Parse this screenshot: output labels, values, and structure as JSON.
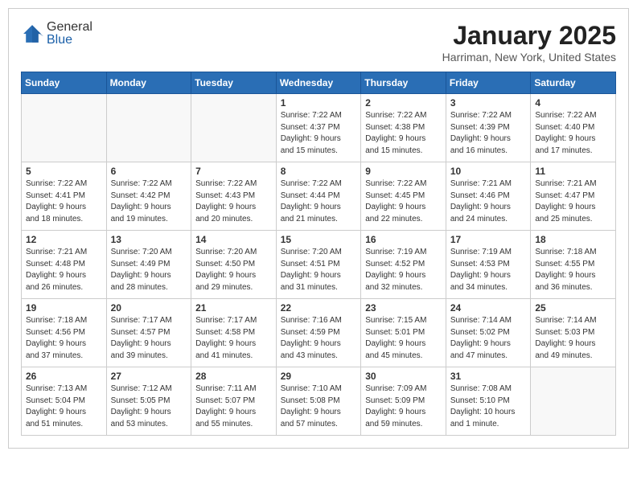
{
  "header": {
    "logo_general": "General",
    "logo_blue": "Blue",
    "month": "January 2025",
    "location": "Harriman, New York, United States"
  },
  "days_of_week": [
    "Sunday",
    "Monday",
    "Tuesday",
    "Wednesday",
    "Thursday",
    "Friday",
    "Saturday"
  ],
  "weeks": [
    [
      {
        "day": "",
        "info": ""
      },
      {
        "day": "",
        "info": ""
      },
      {
        "day": "",
        "info": ""
      },
      {
        "day": "1",
        "info": "Sunrise: 7:22 AM\nSunset: 4:37 PM\nDaylight: 9 hours\nand 15 minutes."
      },
      {
        "day": "2",
        "info": "Sunrise: 7:22 AM\nSunset: 4:38 PM\nDaylight: 9 hours\nand 15 minutes."
      },
      {
        "day": "3",
        "info": "Sunrise: 7:22 AM\nSunset: 4:39 PM\nDaylight: 9 hours\nand 16 minutes."
      },
      {
        "day": "4",
        "info": "Sunrise: 7:22 AM\nSunset: 4:40 PM\nDaylight: 9 hours\nand 17 minutes."
      }
    ],
    [
      {
        "day": "5",
        "info": "Sunrise: 7:22 AM\nSunset: 4:41 PM\nDaylight: 9 hours\nand 18 minutes."
      },
      {
        "day": "6",
        "info": "Sunrise: 7:22 AM\nSunset: 4:42 PM\nDaylight: 9 hours\nand 19 minutes."
      },
      {
        "day": "7",
        "info": "Sunrise: 7:22 AM\nSunset: 4:43 PM\nDaylight: 9 hours\nand 20 minutes."
      },
      {
        "day": "8",
        "info": "Sunrise: 7:22 AM\nSunset: 4:44 PM\nDaylight: 9 hours\nand 21 minutes."
      },
      {
        "day": "9",
        "info": "Sunrise: 7:22 AM\nSunset: 4:45 PM\nDaylight: 9 hours\nand 22 minutes."
      },
      {
        "day": "10",
        "info": "Sunrise: 7:21 AM\nSunset: 4:46 PM\nDaylight: 9 hours\nand 24 minutes."
      },
      {
        "day": "11",
        "info": "Sunrise: 7:21 AM\nSunset: 4:47 PM\nDaylight: 9 hours\nand 25 minutes."
      }
    ],
    [
      {
        "day": "12",
        "info": "Sunrise: 7:21 AM\nSunset: 4:48 PM\nDaylight: 9 hours\nand 26 minutes."
      },
      {
        "day": "13",
        "info": "Sunrise: 7:20 AM\nSunset: 4:49 PM\nDaylight: 9 hours\nand 28 minutes."
      },
      {
        "day": "14",
        "info": "Sunrise: 7:20 AM\nSunset: 4:50 PM\nDaylight: 9 hours\nand 29 minutes."
      },
      {
        "day": "15",
        "info": "Sunrise: 7:20 AM\nSunset: 4:51 PM\nDaylight: 9 hours\nand 31 minutes."
      },
      {
        "day": "16",
        "info": "Sunrise: 7:19 AM\nSunset: 4:52 PM\nDaylight: 9 hours\nand 32 minutes."
      },
      {
        "day": "17",
        "info": "Sunrise: 7:19 AM\nSunset: 4:53 PM\nDaylight: 9 hours\nand 34 minutes."
      },
      {
        "day": "18",
        "info": "Sunrise: 7:18 AM\nSunset: 4:55 PM\nDaylight: 9 hours\nand 36 minutes."
      }
    ],
    [
      {
        "day": "19",
        "info": "Sunrise: 7:18 AM\nSunset: 4:56 PM\nDaylight: 9 hours\nand 37 minutes."
      },
      {
        "day": "20",
        "info": "Sunrise: 7:17 AM\nSunset: 4:57 PM\nDaylight: 9 hours\nand 39 minutes."
      },
      {
        "day": "21",
        "info": "Sunrise: 7:17 AM\nSunset: 4:58 PM\nDaylight: 9 hours\nand 41 minutes."
      },
      {
        "day": "22",
        "info": "Sunrise: 7:16 AM\nSunset: 4:59 PM\nDaylight: 9 hours\nand 43 minutes."
      },
      {
        "day": "23",
        "info": "Sunrise: 7:15 AM\nSunset: 5:01 PM\nDaylight: 9 hours\nand 45 minutes."
      },
      {
        "day": "24",
        "info": "Sunrise: 7:14 AM\nSunset: 5:02 PM\nDaylight: 9 hours\nand 47 minutes."
      },
      {
        "day": "25",
        "info": "Sunrise: 7:14 AM\nSunset: 5:03 PM\nDaylight: 9 hours\nand 49 minutes."
      }
    ],
    [
      {
        "day": "26",
        "info": "Sunrise: 7:13 AM\nSunset: 5:04 PM\nDaylight: 9 hours\nand 51 minutes."
      },
      {
        "day": "27",
        "info": "Sunrise: 7:12 AM\nSunset: 5:05 PM\nDaylight: 9 hours\nand 53 minutes."
      },
      {
        "day": "28",
        "info": "Sunrise: 7:11 AM\nSunset: 5:07 PM\nDaylight: 9 hours\nand 55 minutes."
      },
      {
        "day": "29",
        "info": "Sunrise: 7:10 AM\nSunset: 5:08 PM\nDaylight: 9 hours\nand 57 minutes."
      },
      {
        "day": "30",
        "info": "Sunrise: 7:09 AM\nSunset: 5:09 PM\nDaylight: 9 hours\nand 59 minutes."
      },
      {
        "day": "31",
        "info": "Sunrise: 7:08 AM\nSunset: 5:10 PM\nDaylight: 10 hours\nand 1 minute."
      },
      {
        "day": "",
        "info": ""
      }
    ]
  ]
}
